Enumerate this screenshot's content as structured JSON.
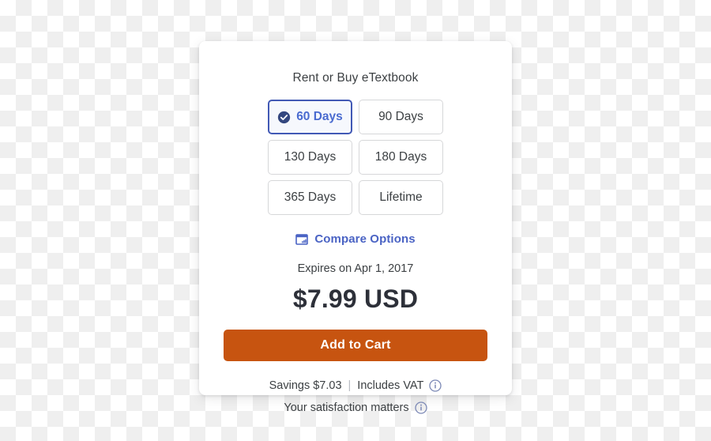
{
  "card": {
    "title": "Rent or Buy eTextbook",
    "terms": [
      {
        "label": "60 Days",
        "selected": true,
        "icon": "check-circle-icon"
      },
      {
        "label": "90 Days",
        "selected": false,
        "icon": ""
      },
      {
        "label": "130 Days",
        "selected": false,
        "icon": ""
      },
      {
        "label": "180 Days",
        "selected": false,
        "icon": ""
      },
      {
        "label": "365 Days",
        "selected": false,
        "icon": ""
      },
      {
        "label": "Lifetime",
        "selected": false,
        "icon": ""
      }
    ],
    "compare": {
      "label": "Compare Options",
      "icon": "compare-table-icon"
    },
    "expires": "Expires on Apr 1, 2017",
    "price": "$7.99 USD",
    "cta_label": "Add to Cart",
    "savings_label": "Savings $7.03",
    "divider": "|",
    "vat_label": "Includes VAT",
    "vat_info_icon": "info-icon",
    "satisfaction_label": "Your satisfaction matters",
    "satisfaction_info_icon": "info-icon"
  },
  "colors": {
    "accent_orange": "#c75410",
    "selected_border": "#4259b5",
    "selected_text": "#4a6bd0",
    "selected_fill": "#f6f8fd",
    "check_circle": "#34477f",
    "link_blue": "#4a63c4",
    "border_gray": "#d6d7d9",
    "text_dark": "#3c4043",
    "price_dark": "#2d3039",
    "info_gray_blue": "#7b88b5",
    "card_bg": "#ffffff",
    "checker_light": "#ffffff",
    "checker_dark": "#efefef"
  }
}
